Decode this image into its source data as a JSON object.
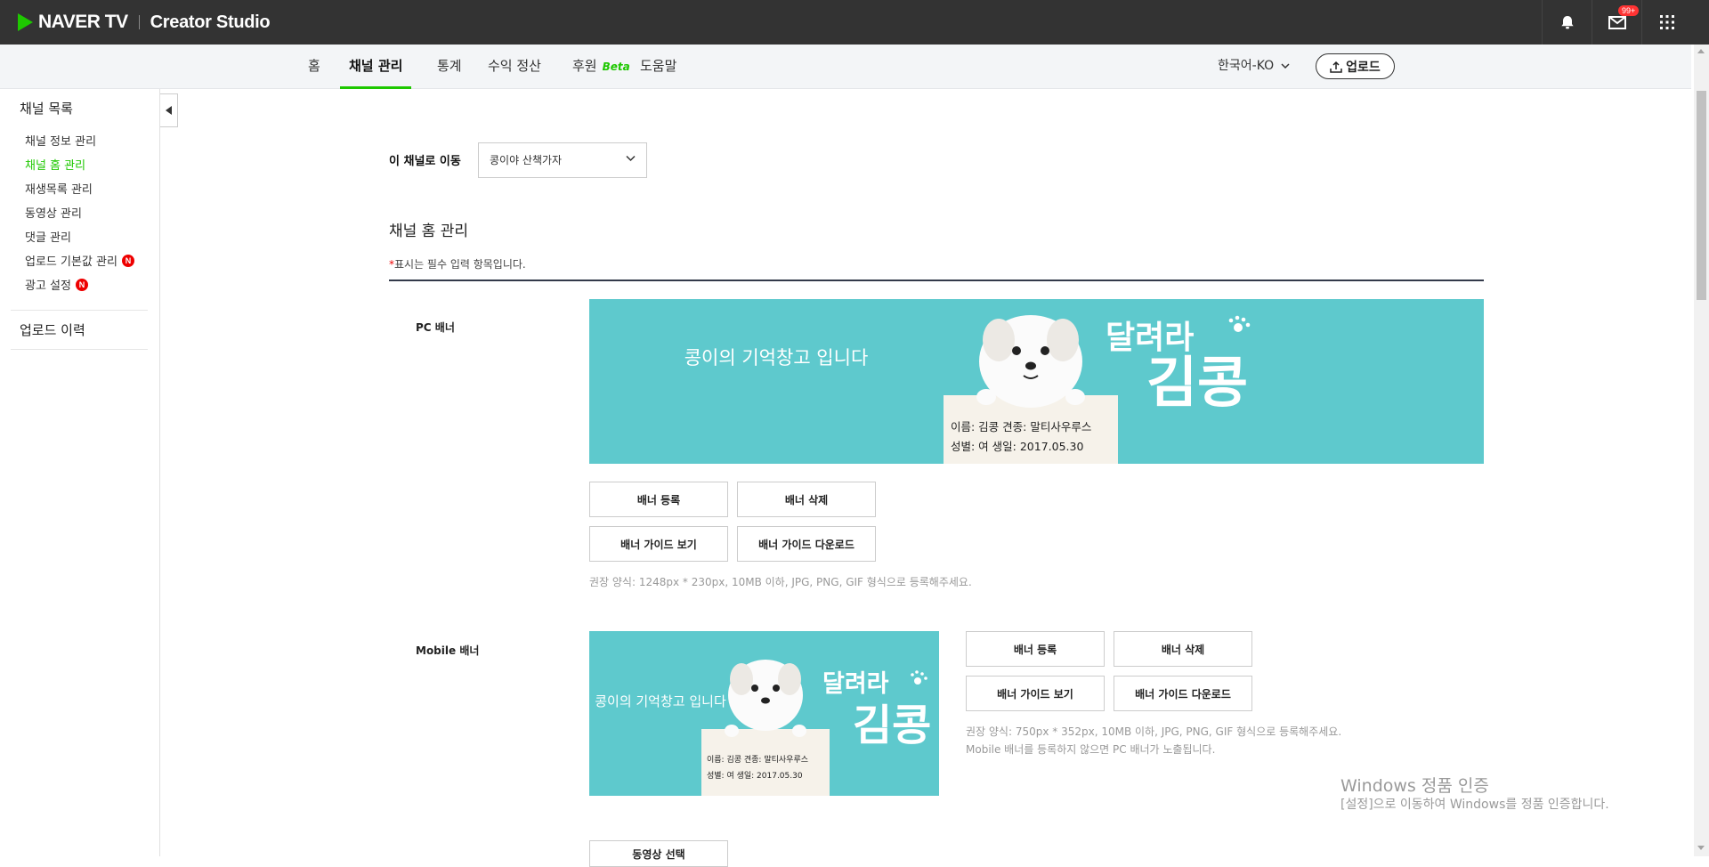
{
  "header": {
    "brand": "NAVER TV",
    "studio": "Creator Studio",
    "notification_badge": "99+",
    "icons": [
      "bell-icon",
      "mail-icon",
      "apps-grid-icon"
    ]
  },
  "nav": {
    "tabs": [
      "홈",
      "채널 관리",
      "통계",
      "수익 정산",
      "후원",
      "도움말"
    ],
    "beta_label": "Beta",
    "active_tab": "채널 관리",
    "language": "한국어-KO",
    "upload_label": "업로드"
  },
  "sidebar": {
    "section_title": "채널 목록",
    "items": [
      {
        "label": "채널 정보 관리",
        "active": false,
        "new": false
      },
      {
        "label": "채널 홈 관리",
        "active": true,
        "new": false
      },
      {
        "label": "재생목록 관리",
        "active": false,
        "new": false
      },
      {
        "label": "동영상 관리",
        "active": false,
        "new": false
      },
      {
        "label": "댓글 관리",
        "active": false,
        "new": false
      },
      {
        "label": "업로드 기본값 관리",
        "active": false,
        "new": true
      },
      {
        "label": "광고 설정",
        "active": false,
        "new": true
      }
    ],
    "new_badge": "N",
    "upload_history": "업로드 이력"
  },
  "main": {
    "move_label": "이 채널로 이동",
    "channel_select": "콩이야 산책가자",
    "section_title": "채널 홈 관리",
    "required_star": "*",
    "required_note": "표시는 필수 입력 항목입니다.",
    "pc_banner": {
      "label": "PC 배너",
      "register": "배너 등록",
      "delete": "배너 삭제",
      "guide_view": "배너 가이드 보기",
      "guide_download": "배너 가이드 다운로드",
      "hint": "권장 양식: 1248px * 230px, 10MB 이하, JPG, PNG, GIF 형식으로 등록해주세요."
    },
    "mobile_banner": {
      "label": "Mobile 배너",
      "register": "배너 등록",
      "delete": "배너 삭제",
      "guide_view": "배너 가이드 보기",
      "guide_download": "배너 가이드 다운로드",
      "hint1": "권장 양식: 750px * 352px, 10MB 이하, JPG, PNG, GIF 형식으로 등록해주세요.",
      "hint2": "Mobile 배너를 등록하지 않으면 PC 배너가 노출됩니다."
    },
    "banner_image": {
      "caption": "콩이의 기억창고 입니다",
      "title_small": "달려라",
      "title_big": "김콩",
      "card_line1": "이름: 김콩   견종: 말티사우루스",
      "card_line2": "성별: 여    생일: 2017.05.30"
    },
    "bottom_button": "동영상 선택"
  },
  "watermark": {
    "line1": "Windows 정품 인증",
    "line2": "[설정]으로 이동하여 Windows를 정품 인증합니다."
  },
  "colors": {
    "accent": "#1ec800",
    "topbar": "#333333",
    "banner_bg": "#5ec9cd"
  }
}
